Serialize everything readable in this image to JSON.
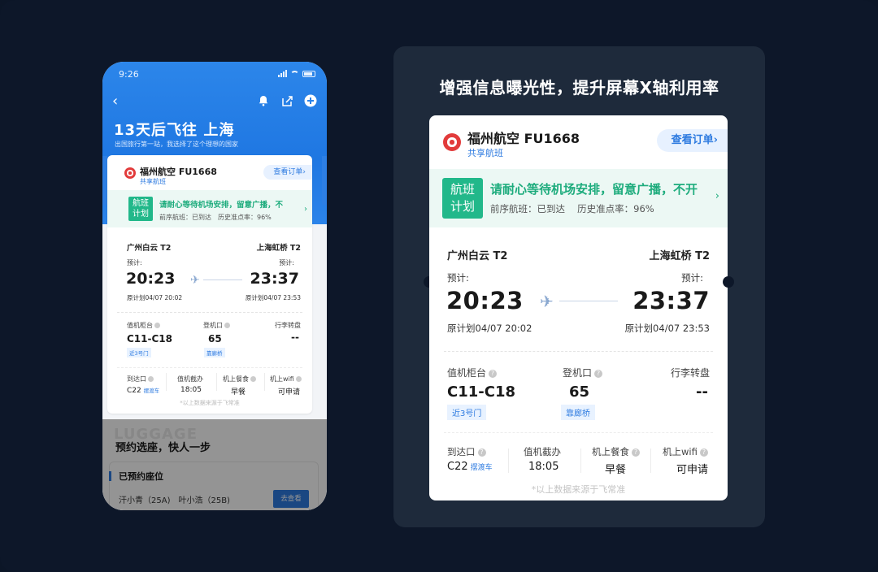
{
  "phone": {
    "status_time": "9:26",
    "hero_title": "13天后飞往 上海",
    "hero_sub": "出国旅行第一站，我选择了这个理想的国家",
    "card": {
      "airline": "福州航空 FU1668",
      "share": "共享航班",
      "order_btn": "查看订单›",
      "notice_badge_1": "航班",
      "notice_badge_2": "计划",
      "notice_text": "请耐心等待机场安排，留意广播，不",
      "notice_sub": "前序航班：已到达　历史准点率：96%",
      "dep_airport": "广州白云 T2",
      "arr_airport": "上海虹桥 T2",
      "est_label": "预计:",
      "dep_time": "20:23",
      "arr_time": "23:37",
      "dep_plan": "原计划04/07 20:02",
      "arr_plan": "原计划04/07 23:53",
      "checkin_label": "值机柜台",
      "checkin_val": "C11-C18",
      "checkin_tag": "近3号门",
      "gate_label": "登机口",
      "gate_val": "65",
      "gate_tag": "靠廊桥",
      "baggage_label": "行李转盘",
      "baggage_val": "--",
      "arrival_exit_label": "到达口",
      "arrival_exit_val": "C22",
      "shuttle": "摆渡车",
      "checkin_close_label": "值机截办",
      "checkin_close_val": "18:05",
      "meal_label": "机上餐食",
      "meal_val": "早餐",
      "wifi_label": "机上wifi",
      "wifi_val": "可申请",
      "footer": "*以上数据来源于飞常准"
    },
    "ghost_text": "LUGGAGE",
    "lower_title": "预约选座，快人一步",
    "booked_title": "已预约座位",
    "passengers": "汗小青（25A)　叶小浩（25B)",
    "goto_btn": "去查看"
  },
  "panel": {
    "headline": "增强信息曝光性，提升屏幕X轴利用率",
    "card": {
      "airline": "福州航空 FU1668",
      "share": "共享航班",
      "order_btn": "查看订单›",
      "notice_badge_1": "航班",
      "notice_badge_2": "计划",
      "notice_text": "请耐心等待机场安排，留意广播，不开",
      "notice_sub": "前序航班：已到达　 历史准点率：96%",
      "dep_airport": "广州白云 T2",
      "arr_airport": "上海虹桥 T2",
      "est_label": "预计:",
      "dep_time": "20:23",
      "arr_time": "23:37",
      "dep_plan": "原计划04/07 20:02",
      "arr_plan": "原计划04/07 23:53",
      "checkin_label": "值机柜台",
      "checkin_val": "C11-C18",
      "checkin_tag": "近3号门",
      "gate_label": "登机口",
      "gate_val": "65",
      "gate_tag": "靠廊桥",
      "baggage_label": "行李转盘",
      "baggage_val": "--",
      "arrival_exit_label": "到达口",
      "arrival_exit_val": "C22",
      "shuttle": "摆渡车",
      "checkin_close_label": "值机截办",
      "checkin_close_val": "18:05",
      "meal_label": "机上餐食",
      "meal_val": "早餐",
      "wifi_label": "机上wifi",
      "wifi_val": "可申请",
      "footer": "*以上数据来源于飞常准"
    }
  },
  "colors": {
    "background": "#0d1729",
    "panel": "#1e2a3b",
    "accent_blue": "#2e7be0",
    "accent_green": "#22b88a",
    "brand_red": "#e23b3b"
  },
  "icons": [
    "back-icon",
    "bell-icon",
    "share-icon",
    "add-icon",
    "airline-logo-icon",
    "plane-icon",
    "help-icon",
    "chevron-right-icon"
  ]
}
